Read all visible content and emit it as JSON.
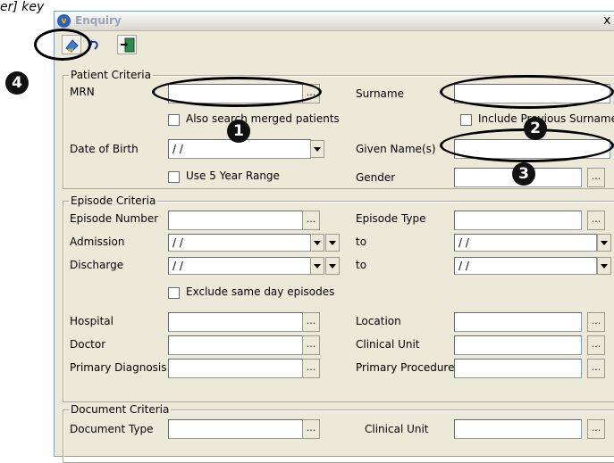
{
  "doc_snippet": "er] key",
  "window": {
    "title": "Enquiry",
    "close_glyph": "x"
  },
  "toolbar": {
    "buttons": [
      {
        "icon": "search-clear-icon"
      },
      {
        "icon": "undo-icon"
      },
      {
        "icon": "exit-door-icon"
      }
    ]
  },
  "patient_criteria": {
    "title": "Patient Criteria",
    "mrn_label": "MRN",
    "surname_label": "Surname",
    "also_search_merged": "Also search merged patients",
    "include_previous_surname": "Include Previous Surname",
    "dob_label": "Date of Birth",
    "dob_value": "/ /",
    "given_names_label": "Given Name(s)",
    "use_5_year_range": "Use 5 Year Range",
    "gender_label": "Gender"
  },
  "episode_criteria": {
    "title": "Episode Criteria",
    "episode_number_label": "Episode Number",
    "episode_type_label": "Episode Type",
    "admission_label": "Admission",
    "admission_value": "/ /",
    "admission_to_label": "to",
    "admission_to_value": "/ /",
    "discharge_label": "Discharge",
    "discharge_value": "/ /",
    "discharge_to_label": "to",
    "discharge_to_value": "/ /",
    "exclude_same_day": "Exclude same day episodes",
    "hospital_label": "Hospital",
    "location_label": "Location",
    "doctor_label": "Doctor",
    "clinical_unit_label": "Clinical Unit",
    "primary_diagnosis_label": "Primary Diagnosis",
    "primary_procedure_label": "Primary Procedure"
  },
  "document_criteria": {
    "title": "Document Criteria",
    "document_type_label": "Document Type",
    "clinical_unit_label": "Clinical Unit"
  },
  "buttons": {
    "ellipsis": "..."
  },
  "callouts": {
    "one": "1",
    "two": "2",
    "three": "3",
    "four": "4"
  }
}
